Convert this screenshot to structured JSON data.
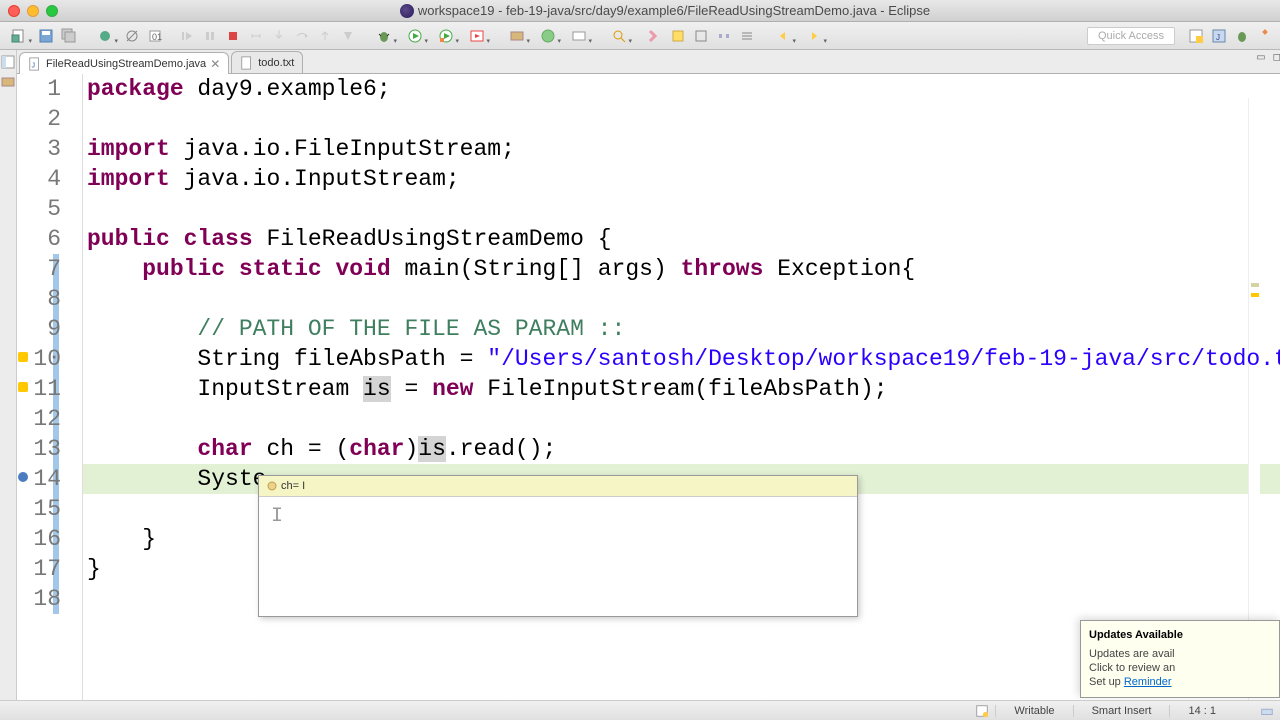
{
  "window": {
    "title": "workspace19 - feb-19-java/src/day9/example6/FileReadUsingStreamDemo.java - Eclipse"
  },
  "quick_access": "Quick Access",
  "tabs": [
    {
      "label": "FileReadUsingStreamDemo.java",
      "active": true,
      "closable": true
    },
    {
      "label": "todo.txt",
      "active": false,
      "closable": false
    }
  ],
  "code": {
    "lines": [
      {
        "n": 1,
        "tokens": [
          [
            "kw",
            "package"
          ],
          [
            "txt",
            " day9.example6;"
          ]
        ]
      },
      {
        "n": 2,
        "tokens": []
      },
      {
        "n": 3,
        "tokens": [
          [
            "kw",
            "import"
          ],
          [
            "txt",
            " java.io.FileInputStream;"
          ]
        ]
      },
      {
        "n": 4,
        "tokens": [
          [
            "kw",
            "import"
          ],
          [
            "txt",
            " java.io.InputStream;"
          ]
        ]
      },
      {
        "n": 5,
        "tokens": []
      },
      {
        "n": 6,
        "tokens": [
          [
            "kw",
            "public"
          ],
          [
            "txt",
            " "
          ],
          [
            "kw",
            "class"
          ],
          [
            "txt",
            " FileReadUsingStreamDemo {"
          ]
        ]
      },
      {
        "n": 7,
        "tokens": [
          [
            "txt",
            "    "
          ],
          [
            "kw",
            "public"
          ],
          [
            "txt",
            " "
          ],
          [
            "kw",
            "static"
          ],
          [
            "txt",
            " "
          ],
          [
            "kw",
            "void"
          ],
          [
            "txt",
            " main(String[] args) "
          ],
          [
            "kw",
            "throws"
          ],
          [
            "txt",
            " Exception{"
          ]
        ]
      },
      {
        "n": 8,
        "tokens": []
      },
      {
        "n": 9,
        "tokens": [
          [
            "txt",
            "        "
          ],
          [
            "cmt",
            "// PATH OF THE FILE AS PARAM ::"
          ]
        ]
      },
      {
        "n": 10,
        "tokens": [
          [
            "txt",
            "        String fileAbsPath = "
          ],
          [
            "str",
            "\"/Users/santosh/Desktop/workspace19/feb-19-java/src/todo.t"
          ]
        ]
      },
      {
        "n": 11,
        "tokens": [
          [
            "txt",
            "        InputStream "
          ],
          [
            "var-hl",
            "is"
          ],
          [
            "txt",
            " = "
          ],
          [
            "kw",
            "new"
          ],
          [
            "txt",
            " FileInputStream(fileAbsPath);"
          ]
        ]
      },
      {
        "n": 12,
        "tokens": []
      },
      {
        "n": 13,
        "tokens": [
          [
            "txt",
            "        "
          ],
          [
            "kw",
            "char"
          ],
          [
            "txt",
            " ch = ("
          ],
          [
            "kw",
            "char"
          ],
          [
            "txt",
            ")"
          ],
          [
            "var-hl",
            "is"
          ],
          [
            "txt",
            ".read();"
          ]
        ]
      },
      {
        "n": 14,
        "tokens": [
          [
            "txt",
            "        Syste"
          ]
        ]
      },
      {
        "n": 15,
        "tokens": []
      },
      {
        "n": 16,
        "tokens": [
          [
            "txt",
            "    }"
          ]
        ]
      },
      {
        "n": 17,
        "tokens": [
          [
            "txt",
            "}"
          ]
        ]
      },
      {
        "n": 18,
        "tokens": []
      }
    ],
    "highlight_line": 14,
    "cursor_text": "I"
  },
  "hover": {
    "label": "ch= I"
  },
  "status": {
    "writable": "Writable",
    "insert": "Smart Insert",
    "pos": "14 : 1"
  },
  "updates": {
    "title": "Updates Available",
    "line1": "Updates are avail",
    "line2": "Click to review an",
    "line3_pre": "Set up ",
    "line3_link": "Reminder"
  },
  "annotations": {
    "line10": "warn",
    "line11": "warn",
    "line14": "bp"
  }
}
